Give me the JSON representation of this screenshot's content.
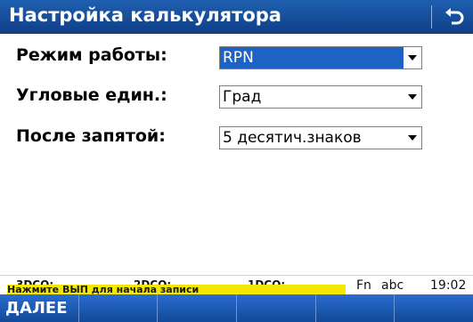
{
  "window": {
    "title": "Настройка калькулятора",
    "back_icon": "back-arrow-icon"
  },
  "form": {
    "rows": [
      {
        "label": "Режим работы:",
        "value": "RPN",
        "selected": true
      },
      {
        "label": "Угловые един.:",
        "value": "Град",
        "selected": false
      },
      {
        "label": "После запятой:",
        "value": "5 десятич.знаков",
        "selected": false
      }
    ]
  },
  "statusbar": {
    "items": [
      "3DCQ:",
      "2DCQ:",
      "1DCQ:"
    ],
    "hint": "Нажмите ВЫП для начала записи",
    "input_mode_fn": "Fn",
    "input_mode_text": "abc",
    "time": "19:02"
  },
  "softkeys": {
    "f1": "ДАЛЕЕ",
    "f2": "",
    "f3": "",
    "f4": "",
    "f5": "",
    "f6": ""
  },
  "colors": {
    "titlebar": "#1f5fb0",
    "selection": "#1d63c4",
    "hint_bg": "#f5e800",
    "softkey_bg": "#1a5bb5"
  }
}
